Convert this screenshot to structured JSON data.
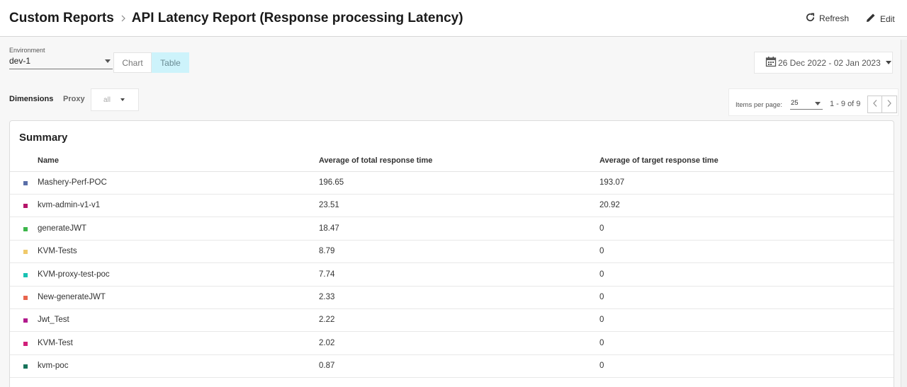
{
  "breadcrumb": {
    "root": "Custom Reports",
    "current": "API Latency Report (Response processing Latency)"
  },
  "header_actions": {
    "refresh_label": "Refresh",
    "edit_label": "Edit"
  },
  "environment": {
    "label": "Environment",
    "value": "dev-1"
  },
  "view_toggle": {
    "chart_label": "Chart",
    "table_label": "Table",
    "selected": "Table"
  },
  "date_range": {
    "value": "26 Dec 2022 - 02 Jan 2023"
  },
  "dimensions": {
    "label": "Dimensions",
    "proxy_label": "Proxy",
    "proxy_value": "all"
  },
  "pagination": {
    "items_per_page_label": "Items per page:",
    "items_per_page": "25",
    "range_text": "1 - 9 of 9"
  },
  "summary": {
    "title": "Summary",
    "columns": [
      "Name",
      "Average of total response time",
      "Average of target response time"
    ],
    "rows": [
      {
        "name": "Mashery-Perf-POC",
        "total": "196.65",
        "target": "193.07",
        "color": "#5a6fa8"
      },
      {
        "name": "kvm-admin-v1-v1",
        "total": "23.51",
        "target": "20.92",
        "color": "#b5156a"
      },
      {
        "name": "generateJWT",
        "total": "18.47",
        "target": "0",
        "color": "#3cb64a"
      },
      {
        "name": "KVM-Tests",
        "total": "8.79",
        "target": "0",
        "color": "#f0c96a"
      },
      {
        "name": "KVM-proxy-test-poc",
        "total": "7.74",
        "target": "0",
        "color": "#19c2b3"
      },
      {
        "name": "New-generateJWT",
        "total": "2.33",
        "target": "0",
        "color": "#e8654d"
      },
      {
        "name": "Jwt_Test",
        "total": "2.22",
        "target": "0",
        "color": "#b21a8c"
      },
      {
        "name": "KVM-Test",
        "total": "2.02",
        "target": "0",
        "color": "#d11f7a"
      },
      {
        "name": "kvm-poc",
        "total": "0.87",
        "target": "0",
        "color": "#17735a"
      }
    ]
  }
}
